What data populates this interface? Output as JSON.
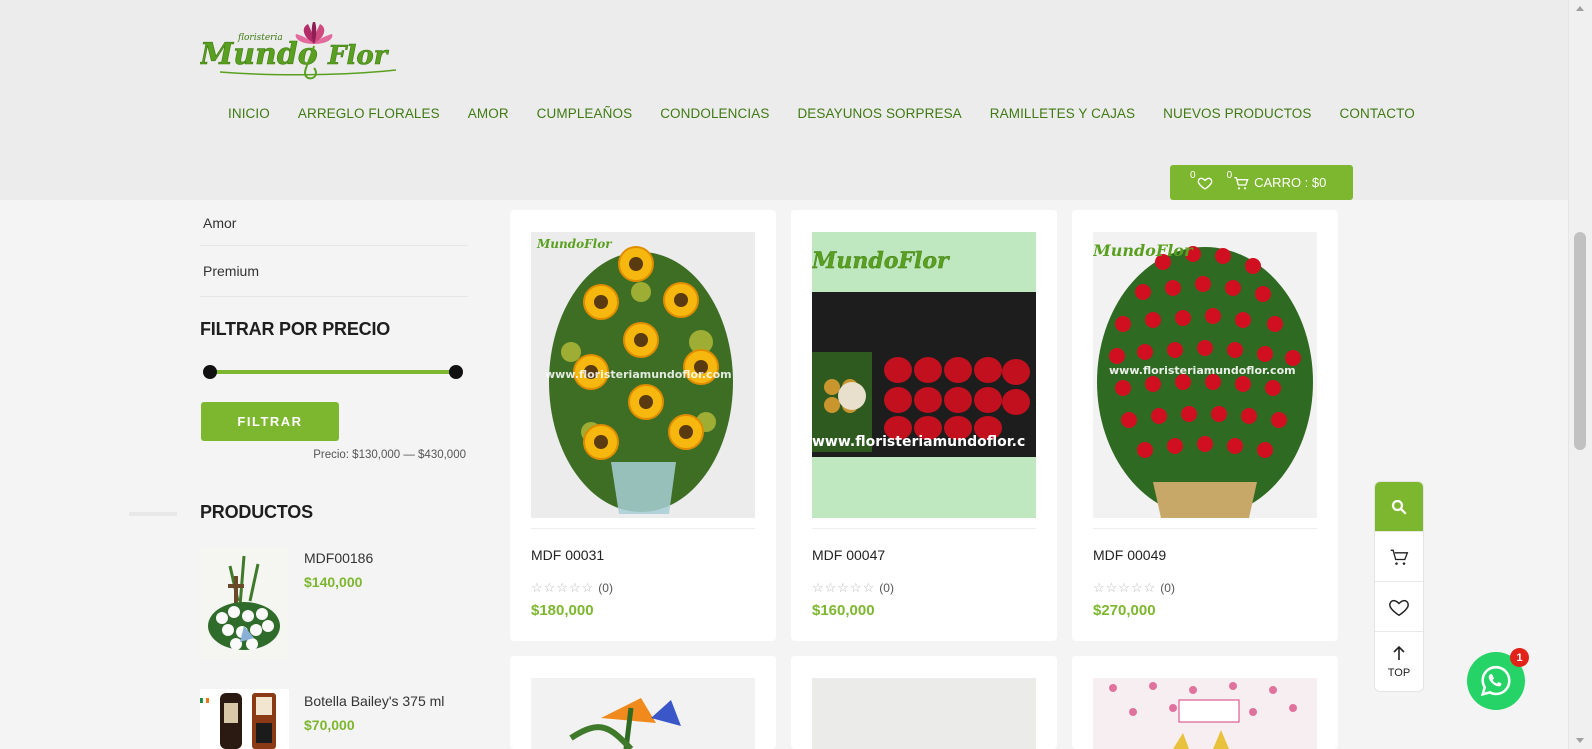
{
  "header": {
    "logo_small": "floristeria",
    "logo_main": "MundoFlor",
    "nav": [
      "INICIO",
      "ARREGLO FLORALES",
      "AMOR",
      "CUMPLEAÑOS",
      "CONDOLENCIAS",
      "DESAYUNOS SORPRESA",
      "RAMILLETES Y CAJAS",
      "NUEVOS PRODUCTOS",
      "CONTACTO"
    ],
    "wishlist_count": "0",
    "cart_count": "0",
    "cart_label": "CARRO : $0"
  },
  "sidebar": {
    "categories": [
      "Amor",
      "Premium"
    ],
    "price_filter_title": "FILTRAR POR PRECIO",
    "filter_button": "FILTRAR",
    "price_range": "Precio: $130,000 — $430,000",
    "products_title": "PRODUCTOS",
    "products": [
      {
        "name": "MDF00186",
        "price": "$140,000"
      },
      {
        "name": "Botella Bailey's 375 ml",
        "price": "$70,000"
      }
    ]
  },
  "products": [
    {
      "name": "MDF 00031",
      "rating_count": "(0)",
      "price": "$180,000",
      "watermark": "www.floristeriamundoflor.com"
    },
    {
      "name": "MDF 00047",
      "rating_count": "(0)",
      "price": "$160,000",
      "watermark": "www.floristeriamundoflor.c"
    },
    {
      "name": "MDF 00049",
      "rating_count": "(0)",
      "price": "$270,000",
      "watermark": "www.floristeriamundoflor.com"
    }
  ],
  "float_bar": {
    "top_label": "TOP"
  },
  "whatsapp": {
    "badge": "1"
  },
  "colors": {
    "accent": "#7db72f",
    "nav_text": "#3f7a12",
    "header_bg": "#ececec"
  }
}
